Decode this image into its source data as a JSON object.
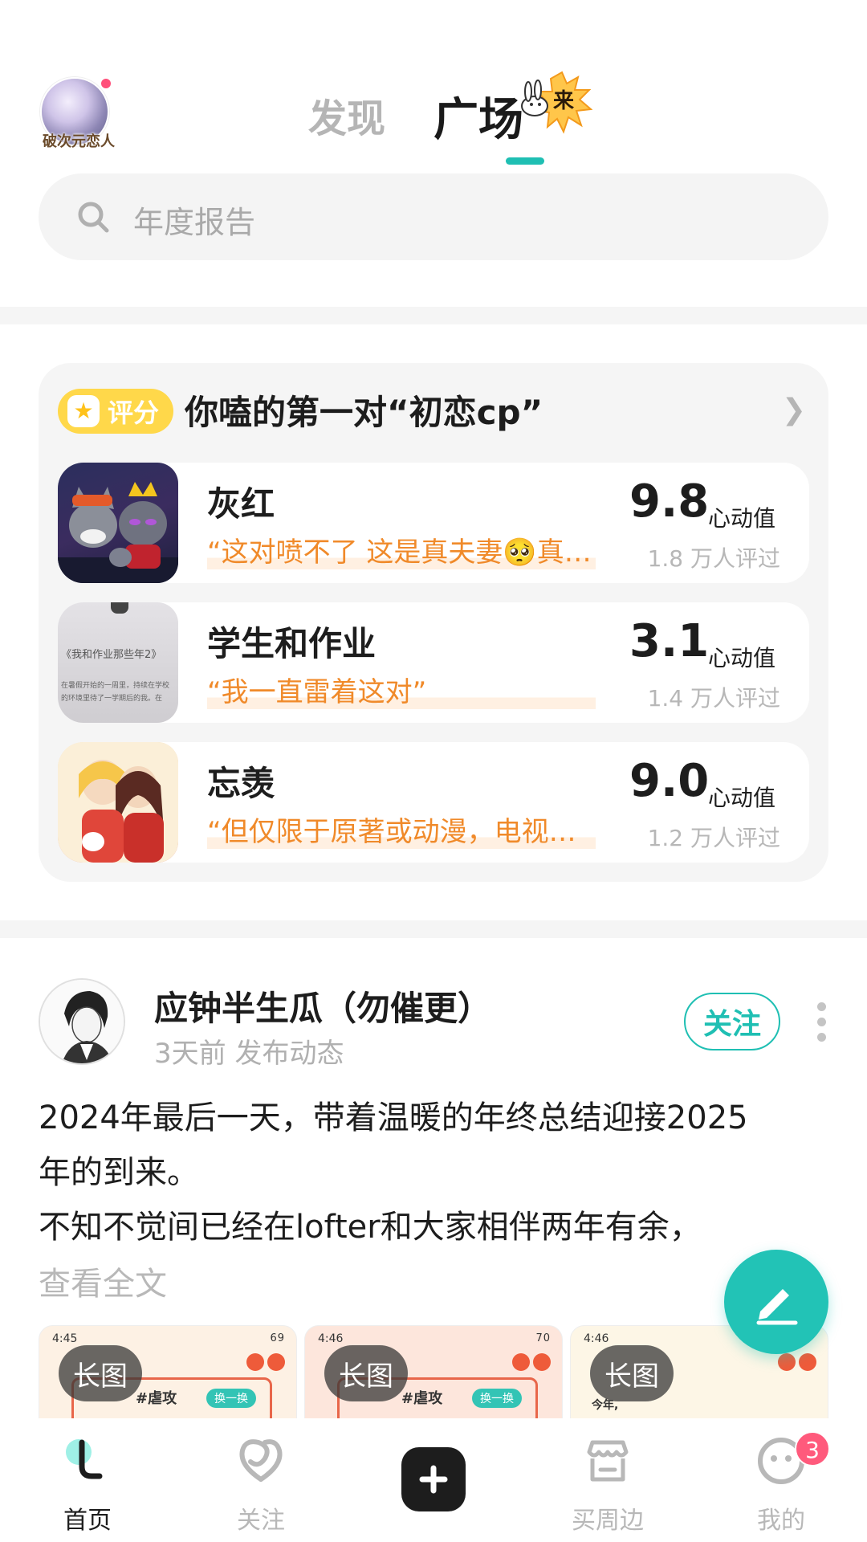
{
  "header": {
    "avatar_caption": "破次元恋人",
    "tabs": [
      {
        "label": "发现",
        "active": false
      },
      {
        "label": "广场",
        "active": true
      }
    ],
    "tab_deco_text": "来"
  },
  "search": {
    "placeholder": "年度报告",
    "icon": "search-icon"
  },
  "rating": {
    "badge": "评分",
    "title": "你嗑的第一对“初恋cp”",
    "items": [
      {
        "name": "灰红",
        "quote": "“这对喷不了 这是真夫妻🥺真…",
        "score": "9.8",
        "unit": "心动值",
        "count": "1.8 万人评过"
      },
      {
        "name": "学生和作业",
        "quote": "“我一直雷着这对”",
        "score": "3.1",
        "unit": "心动值",
        "count": "1.4 万人评过"
      },
      {
        "name": "忘羡",
        "quote": "“但仅限于原著或动漫，电视…",
        "score": "9.0",
        "unit": "心动值",
        "count": "1.2 万人评过"
      }
    ],
    "thumb_2_texts": [
      "《我和作业那些年2》",
      "在暑假开始的一周里，持续在学校",
      "的环境里待了一学期后的我。在"
    ]
  },
  "post": {
    "author": "应钟半生瓜（勿催更）",
    "meta": "3天前 发布动态",
    "follow_label": "关注",
    "text_line1": "2024年最后一天，带着温暖的年终总结迎接2025",
    "text_line2": "年的到来。",
    "text_line3": "不知不觉间已经在lofter和大家相伴两年有余，",
    "read_more": "查看全文",
    "images": [
      {
        "label": "长图",
        "time": "4:45",
        "battery": "69",
        "tag": "#虐攻",
        "button": "换一换"
      },
      {
        "label": "长图",
        "time": "4:46",
        "battery": "70",
        "tag": "#虐攻",
        "button": "换一换"
      },
      {
        "label": "长图",
        "time": "4:46",
        "battery": "",
        "tag": "今年,",
        "button": ""
      }
    ]
  },
  "bottom_nav": {
    "items": [
      {
        "label": "首页",
        "icon": "home-icon",
        "active": true
      },
      {
        "label": "关注",
        "icon": "heart-loop-icon",
        "active": false
      },
      {
        "label": "",
        "icon": "plus-icon",
        "active": false
      },
      {
        "label": "买周边",
        "icon": "shop-icon",
        "active": false
      },
      {
        "label": "我的",
        "icon": "face-icon",
        "active": false
      }
    ],
    "badge_count": "3"
  },
  "colors": {
    "accent": "#1fbfb3",
    "badge": "#ffd84a",
    "quote": "#f08a2a",
    "notification": "#ff5a7c"
  }
}
